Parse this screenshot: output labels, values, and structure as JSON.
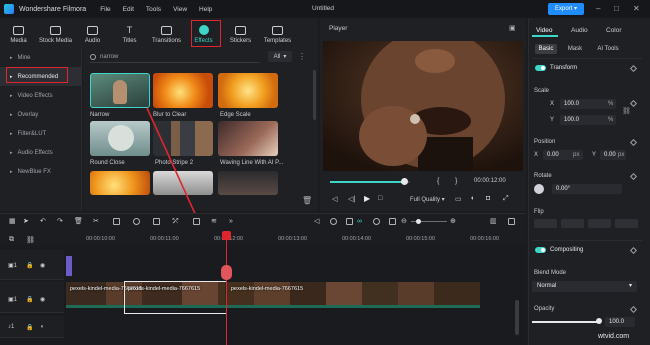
{
  "titlebar": {
    "app_name": "Wondershare Filmora",
    "menus": [
      "File",
      "Edit",
      "Tools",
      "View",
      "Help"
    ],
    "project_title": "Untitled",
    "export_label": "Export"
  },
  "media_tabs": [
    {
      "label": "Media",
      "icon": "media-icon"
    },
    {
      "label": "Stock Media",
      "icon": "stock-media-icon"
    },
    {
      "label": "Audio",
      "icon": "music-note-icon"
    },
    {
      "label": "Titles",
      "icon": "titles-icon"
    },
    {
      "label": "Transitions",
      "icon": "transitions-icon"
    },
    {
      "label": "Effects",
      "icon": "effects-icon",
      "active": true
    },
    {
      "label": "Stickers",
      "icon": "stickers-icon"
    },
    {
      "label": "Templates",
      "icon": "templates-icon"
    }
  ],
  "sidebar": {
    "items": [
      {
        "label": "Mine"
      },
      {
        "label": "Recommended",
        "selected": true
      },
      {
        "label": "Video Effects"
      },
      {
        "label": "Overlay"
      },
      {
        "label": "Filter&LUT"
      },
      {
        "label": "Audio Effects"
      },
      {
        "label": "NewBlue FX"
      }
    ]
  },
  "browser": {
    "search_value": "narrow",
    "filter_value": "All",
    "effects": [
      {
        "label": "Narrow"
      },
      {
        "label": "Blur to Clear"
      },
      {
        "label": "Edge Scale"
      },
      {
        "label": "Round Close"
      },
      {
        "label": "Photo Stripe 2"
      },
      {
        "label": "Waving Line With AI P..."
      }
    ]
  },
  "player": {
    "title": "Player",
    "timecode": "00:00:12:00",
    "quality": "Full Quality",
    "progress": 0.93
  },
  "properties": {
    "tabs": [
      "Video",
      "Audio",
      "Color"
    ],
    "active_tab": "Video",
    "subtabs": [
      "Basic",
      "Mask",
      "AI Tools"
    ],
    "active_subtab": "Basic",
    "transform_label": "Transform",
    "scale_label": "Scale",
    "scale_x_label": "X",
    "scale_x": "100.0",
    "scale_y_label": "Y",
    "scale_y": "100.0",
    "scale_unit": "%",
    "position_label": "Position",
    "pos_x_label": "X",
    "pos_x": "0.00",
    "pos_y_label": "Y",
    "pos_y": "0.00",
    "pos_unit": "px",
    "rotate_label": "Rotate",
    "rotate_value": "0.00°",
    "flip_label": "Flip",
    "compositing_label": "Compositing",
    "blend_mode_label": "Blend Mode",
    "blend_mode_value": "Normal",
    "opacity_label": "Opacity",
    "opacity_value": "100.0",
    "opacity_fraction": 1.0
  },
  "timeline": {
    "ruler_ticks": [
      "00:00:10:00",
      "00:00:11:00",
      "00:00:12:00",
      "00:00:13:00",
      "00:00:14:00",
      "00:00:15:00",
      "00:00:16:00"
    ],
    "clips": [
      {
        "label": "pexels-kindel-media-7667615"
      },
      {
        "label": "pexels-kindel-media-7667615"
      },
      {
        "label": "pexels-kindel-media-7667615"
      }
    ],
    "track_labels": [
      "1",
      "1",
      "1"
    ]
  },
  "watermark": "wtvid.com",
  "colors": {
    "accent": "#3dd6c8",
    "highlight": "#e0262d",
    "export": "#1f8cff"
  }
}
